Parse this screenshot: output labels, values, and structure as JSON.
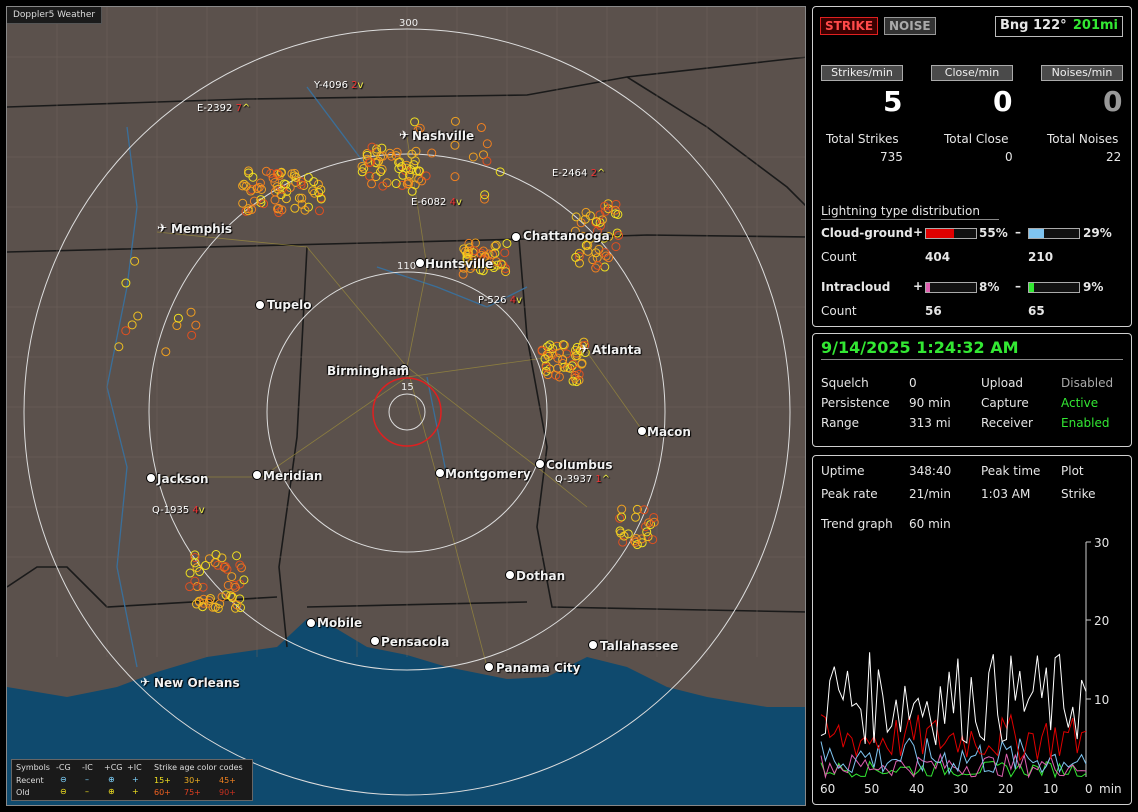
{
  "map": {
    "title": "Doppler5 Weather",
    "rings": [
      "300",
      "110",
      "15"
    ],
    "cities": [
      "Nashville",
      "Memphis",
      "Chattanooga",
      "Huntsville",
      "Tupelo",
      "Birmingham",
      "Atlanta",
      "Macon",
      "Jackson",
      "Meridian",
      "Montgomery",
      "Columbus",
      "Dothan",
      "Mobile",
      "Pensacola",
      "Tallahassee",
      "Panama City",
      "New Orleans"
    ],
    "storms": [
      "Y-4096",
      "2",
      "E-2392",
      "7",
      "E-6082",
      "4",
      "E-2464",
      "2",
      "P-526",
      "4",
      "Q-3937",
      "1",
      "Q-1935",
      "4"
    ],
    "storm_arrows": [
      "v",
      "^"
    ],
    "legend": {
      "symbols_label": "Symbols",
      "col_cg_minus": "-CG",
      "col_ic_minus": "-IC",
      "col_cg_plus": "+CG",
      "col_ic_plus": "+IC",
      "age_title": "Strike age color codes",
      "recent_label": "Recent",
      "old_label": "Old",
      "ages_recent": [
        "15+",
        "30+",
        "45+"
      ],
      "ages_old": [
        "60+",
        "75+",
        "90+"
      ]
    }
  },
  "strike_panel": {
    "strike_button": "STRIKE",
    "noise_button": "NOISE",
    "bearing": "Bng 122°",
    "distance": "201mi",
    "headers": [
      "Strikes/min",
      "Close/min",
      "Noises/min"
    ],
    "rates": [
      "5",
      "0",
      "0"
    ],
    "totals_labels": [
      "Total Strikes",
      "Total Close",
      "Total Noises"
    ],
    "totals_values": [
      "735",
      "0",
      "22"
    ],
    "dist_title": "Lightning type distribution",
    "cg_label": "Cloud-ground",
    "ic_label": "Intracloud",
    "count_label": "Count",
    "plus": "+",
    "minus": "–",
    "cg_plus_pct": "55%",
    "cg_minus_pct": "29%",
    "cg_plus_count": "404",
    "cg_minus_count": "210",
    "ic_plus_pct": "8%",
    "ic_minus_pct": "9%",
    "ic_plus_count": "56",
    "ic_minus_count": "65",
    "cg_plus_frac": 0.55,
    "cg_minus_frac": 0.29,
    "ic_plus_frac": 0.08,
    "ic_minus_frac": 0.09
  },
  "status_panel": {
    "datetime": "9/14/2025 1:24:32 AM",
    "squelch_label": "Squelch",
    "squelch": "0",
    "persistence_label": "Persistence",
    "persistence": "90 min",
    "range_label": "Range",
    "range": "313 mi",
    "upload_label": "Upload",
    "upload": "Disabled",
    "capture_label": "Capture",
    "capture": "Active",
    "receiver_label": "Receiver",
    "receiver": "Enabled"
  },
  "trend_panel": {
    "uptime_label": "Uptime",
    "uptime": "348:40",
    "peaktime_label": "Peak time",
    "peaktime": "1:03 AM",
    "plot_label": "Plot",
    "plot": "Strike",
    "peakrate_label": "Peak rate",
    "peakrate": "21/min",
    "trend_label": "Trend graph",
    "trend": "60 min",
    "y_ticks": [
      "30",
      "20",
      "10"
    ],
    "x_ticks": [
      "60",
      "50",
      "40",
      "30",
      "20",
      "10",
      "0"
    ],
    "x_unit": "min"
  },
  "colors": {
    "accent_red": "#e00000",
    "green": "#33e833",
    "cyan": "#7fd4ff",
    "magenta": "#e060b0"
  }
}
